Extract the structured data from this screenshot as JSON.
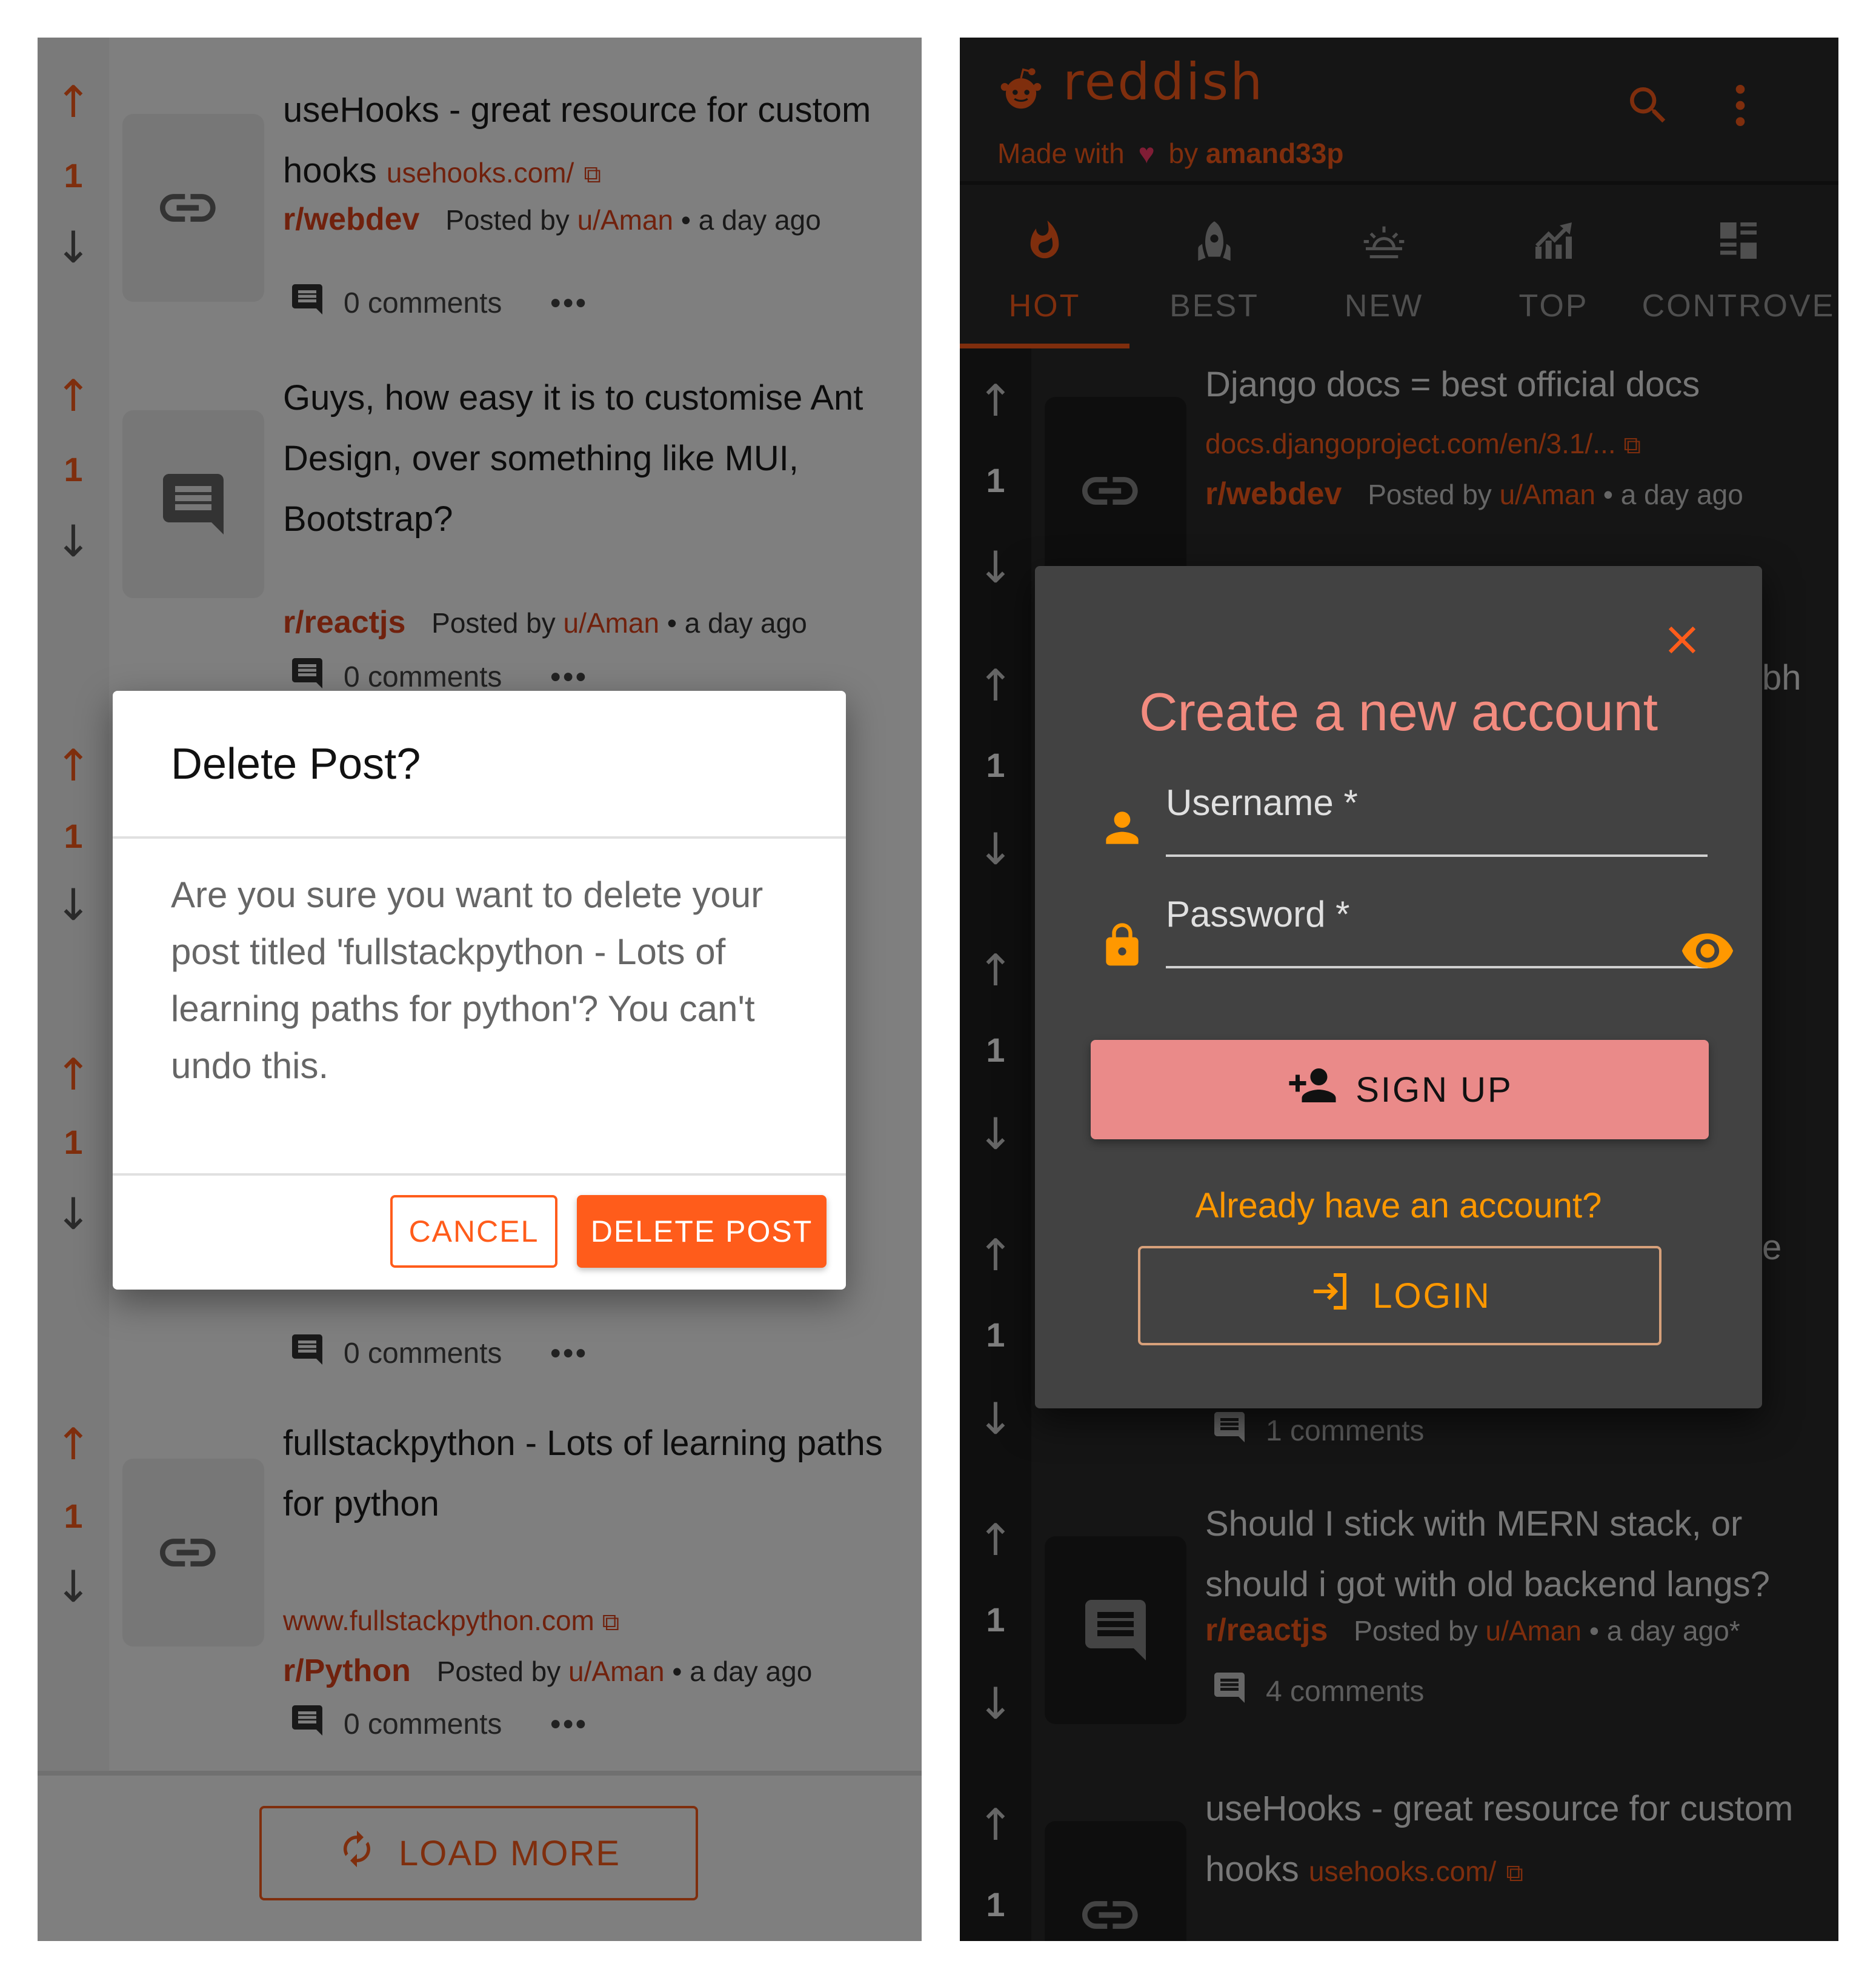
{
  "left": {
    "posts": [
      {
        "title": "useHooks - great resource for custom hooks",
        "domain": "usehooks.com/",
        "subreddit": "r/webdev",
        "posted_by": "Posted by",
        "user": "u/Aman",
        "time": "• a day ago",
        "comments": "0 comments",
        "score": "1",
        "thumb": "link"
      },
      {
        "title": "Guys, how easy it is to customise Ant Design, over something like MUI, Bootstrap?",
        "subreddit": "r/reactjs",
        "posted_by": "Posted by",
        "user": "u/Aman",
        "time": "• a day ago",
        "comments": "0 comments",
        "score": "1",
        "thumb": "text"
      },
      {
        "score": "1"
      },
      {
        "score": "1",
        "comments": "0 comments",
        "thumb": "image"
      },
      {
        "title": "fullstackpython - Lots of learning paths for python",
        "domain": "www.fullstackpython.com",
        "subreddit": "r/Python",
        "posted_by": "Posted by",
        "user": "u/Aman",
        "time": "• a day ago",
        "comments": "0 comments",
        "score": "1",
        "thumb": "link"
      }
    ],
    "more_icon": "•••",
    "load_more": "LOAD MORE",
    "dialog": {
      "title": "Delete Post?",
      "body": "Are you sure you want to delete your post titled 'fullstackpython - Lots of learning paths for python'? You can't undo this.",
      "cancel": "CANCEL",
      "confirm": "DELETE POST"
    }
  },
  "right": {
    "brand": "reddish",
    "made_with": "Made with",
    "heart": "♥",
    "by": "by",
    "author": "amand33p",
    "tabs": [
      {
        "label": "HOT",
        "icon": "flame-icon",
        "active": true
      },
      {
        "label": "BEST",
        "icon": "rocket-icon",
        "active": false
      },
      {
        "label": "NEW",
        "icon": "sunrise-icon",
        "active": false
      },
      {
        "label": "TOP",
        "icon": "trending-icon",
        "active": false
      },
      {
        "label": "CONTROVE",
        "icon": "controversial-icon",
        "active": false
      }
    ],
    "posts": [
      {
        "title": "Django docs = best official docs",
        "domain": "docs.djangoproject.com/en/3.1/...",
        "subreddit": "r/webdev",
        "posted_by": "Posted by",
        "user": "u/Aman",
        "time": "• a day ago",
        "score": "1"
      },
      {
        "partial": "bh",
        "score": "1"
      },
      {
        "score": "1"
      },
      {
        "partial": "e",
        "score": "1",
        "comments": "1 comments"
      },
      {
        "title": "Should I stick with MERN stack, or should i got with old backend langs?",
        "subreddit": "r/reactjs",
        "posted_by": "Posted by",
        "user": "u/Aman",
        "time": "• a day ago*",
        "comments": "4 comments",
        "score": "1"
      },
      {
        "title": "useHooks - great resource for custom hooks",
        "domain": "usehooks.com/",
        "score": "1"
      }
    ],
    "dialog": {
      "title": "Create a new account",
      "username_label": "Username *",
      "password_label": "Password *",
      "signup": "SIGN UP",
      "already": "Already have an account?",
      "login": "LOGIN"
    }
  },
  "colors": {
    "accent": "#ff5c1b",
    "dialog_accent": "#f28b7f",
    "signup_bg": "#ea8a89",
    "login_text": "#ff9800"
  }
}
